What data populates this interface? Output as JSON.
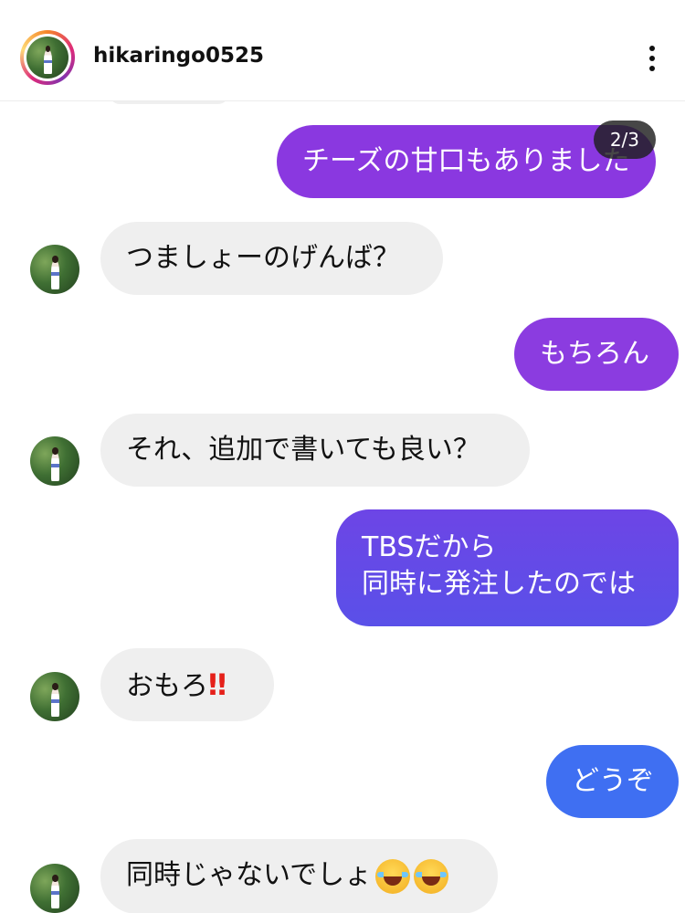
{
  "header": {
    "username": "hikaringo0525"
  },
  "overlay": {
    "counter": "2/3"
  },
  "messages": [
    {
      "dir": "out",
      "text": "チーズの甘口もありました"
    },
    {
      "dir": "in",
      "text": "つましょーのげんば？"
    },
    {
      "dir": "out",
      "text": "もちろん"
    },
    {
      "dir": "in",
      "text": "それ、追加で書いても良い？"
    },
    {
      "dir": "out",
      "text": "TBSだから",
      "text2": "同時に発注したのでは"
    },
    {
      "dir": "in",
      "text": "おもろ",
      "emoji": "‼"
    },
    {
      "dir": "out",
      "text": "どうぞ"
    },
    {
      "dir": "in",
      "text": "同時じゃないでしょ",
      "emoji": "face-with-tears-of-joy-icon x2"
    }
  ],
  "colors": {
    "out_purple": "#8a38e0",
    "out_indigo": "#6a4ae6",
    "out_blue": "#3f6ff2",
    "in_gray": "#efefef"
  }
}
